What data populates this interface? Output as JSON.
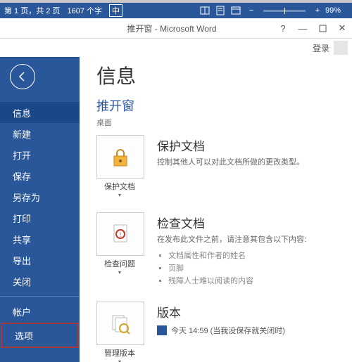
{
  "status": {
    "page": "第 1 页，共 2 页",
    "words": "1607 个字",
    "lang": "中",
    "zoom": "99%"
  },
  "title": "推开窗 - Microsoft Word",
  "account": "登录",
  "sidebar": [
    "信息",
    "新建",
    "打开",
    "保存",
    "另存为",
    "打印",
    "共享",
    "导出",
    "关闭"
  ],
  "sidebar2": [
    "帐户",
    "选项"
  ],
  "page": {
    "heading": "信息",
    "doc": "推开窗",
    "path": "桌面"
  },
  "sections": {
    "protect": {
      "tile": "保护文档",
      "title": "保护文档",
      "desc": "控制其他人可以对此文档所做的更改类型。"
    },
    "inspect": {
      "tile": "检查问题",
      "title": "检查文档",
      "desc": "在发布此文件之前，请注意其包含以下内容:",
      "items": [
        "文档属性和作者的姓名",
        "页脚",
        "残障人士难以阅读的内容"
      ]
    },
    "versions": {
      "tile": "管理版本",
      "title": "版本",
      "entry": "今天 14:59 (当我没保存就关闭时)"
    }
  }
}
